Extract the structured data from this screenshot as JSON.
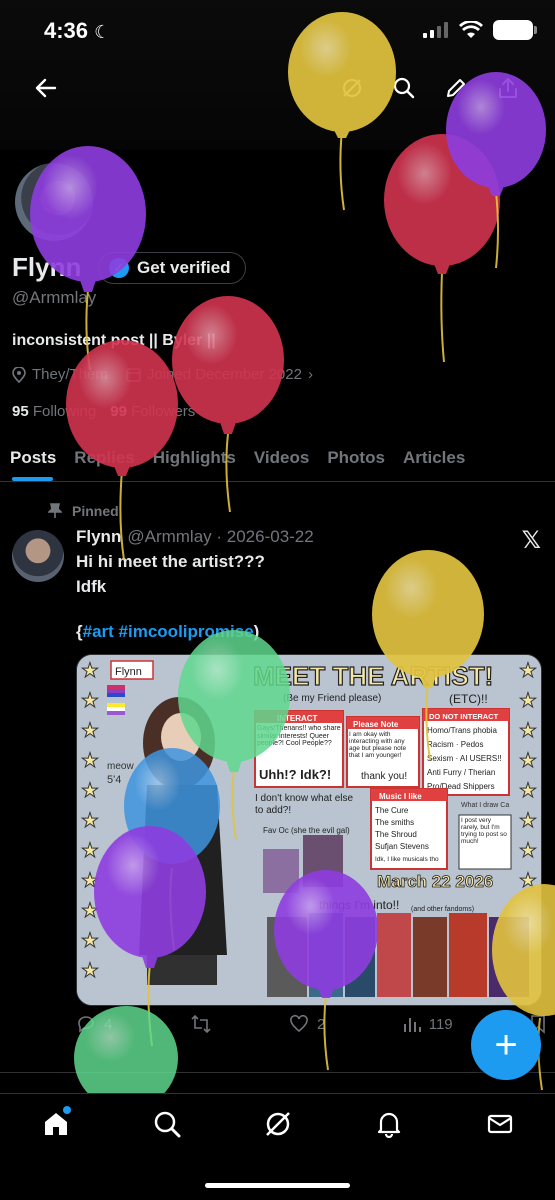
{
  "status_bar": {
    "time": "4:36"
  },
  "profile": {
    "name": "Flynn",
    "verified_label": "Get verified",
    "handle": "@Armmlay",
    "bio": "inconsistent post || Byler ||",
    "pronouns": "They/Them",
    "joined": "Joined December 2022",
    "following_count": "95",
    "following_label": "Following",
    "followers_count": "99",
    "followers_label": "Followers"
  },
  "tabs": [
    {
      "label": "Posts"
    },
    {
      "label": "Replies"
    },
    {
      "label": "Highlights"
    },
    {
      "label": "Videos"
    },
    {
      "label": "Photos"
    },
    {
      "label": "Articles"
    }
  ],
  "post": {
    "pinned_label": "Pinned",
    "author": "Flynn",
    "handle_date": "@Armmlay · 2026-03-22",
    "line1": "Hi hi meet the artist???",
    "line2": "Idfk",
    "tags_open": "{",
    "tag1": "#art",
    "tag2": "#imcoolipromise",
    "tags_close": ")",
    "media": {
      "title": "MEET THE ARTIST!",
      "subtitle": "(Be my Friend please)",
      "etc": "(ETC)!!",
      "name_tag": "Flynn",
      "left_heading": "INTERACT",
      "left_text": "Gays/Therians!! who share similar interests! Queer people?! Cool People??",
      "uhh": "Uhh!? Idk?!",
      "note_heading": "Please Note",
      "note_text": "I am okay with interacting with any age but please note that I am younger!",
      "thank_you": "thank you!",
      "dni_heading": "DO NOT INTERACT",
      "dni_items": [
        "Homo/Trans phobia",
        "Racism · Pedos",
        "Sexism · AI USERS!!",
        "Anti Furry / Therian",
        "Pro/Dead Shippers"
      ],
      "draw_heading": "What I draw Ca",
      "music_heading": "Music I like",
      "music_items": [
        "The Cure",
        "The smiths",
        "The Shroud",
        "Sufjan Stevens",
        "Idk, I like musicals tho"
      ],
      "post_rarely": "I post very rarely, but I'm trying to post so much!",
      "dont_know": "I don't know what else to add?!",
      "fav_oc": "Fav Oc (she the evil gal)",
      "date_text": "March 22 2026",
      "things_into": "things I'm into!!",
      "other_fandoms": "(and other fandoms)",
      "meow": "meow",
      "height": "5'4"
    },
    "stats": {
      "replies": "4",
      "likes": "2",
      "views": "119"
    }
  },
  "colors": {
    "accent": "#1d9bf0",
    "balloon_yellow": "#e2c33f",
    "balloon_purple": "#8e3de0",
    "balloon_red": "#d2334f",
    "balloon_green": "#5fd88e",
    "balloon_blue": "#3f95e0"
  },
  "icons": [
    "back-arrow-icon",
    "grok-icon",
    "search-icon",
    "edit-icon",
    "share-icon",
    "pin-icon",
    "location-icon",
    "calendar-icon",
    "chevron-right-icon",
    "reply-icon",
    "retweet-icon",
    "heart-icon",
    "views-icon",
    "bookmark-icon",
    "compose-icon",
    "home-icon",
    "grok-icon",
    "notifications-icon",
    "messages-icon"
  ]
}
